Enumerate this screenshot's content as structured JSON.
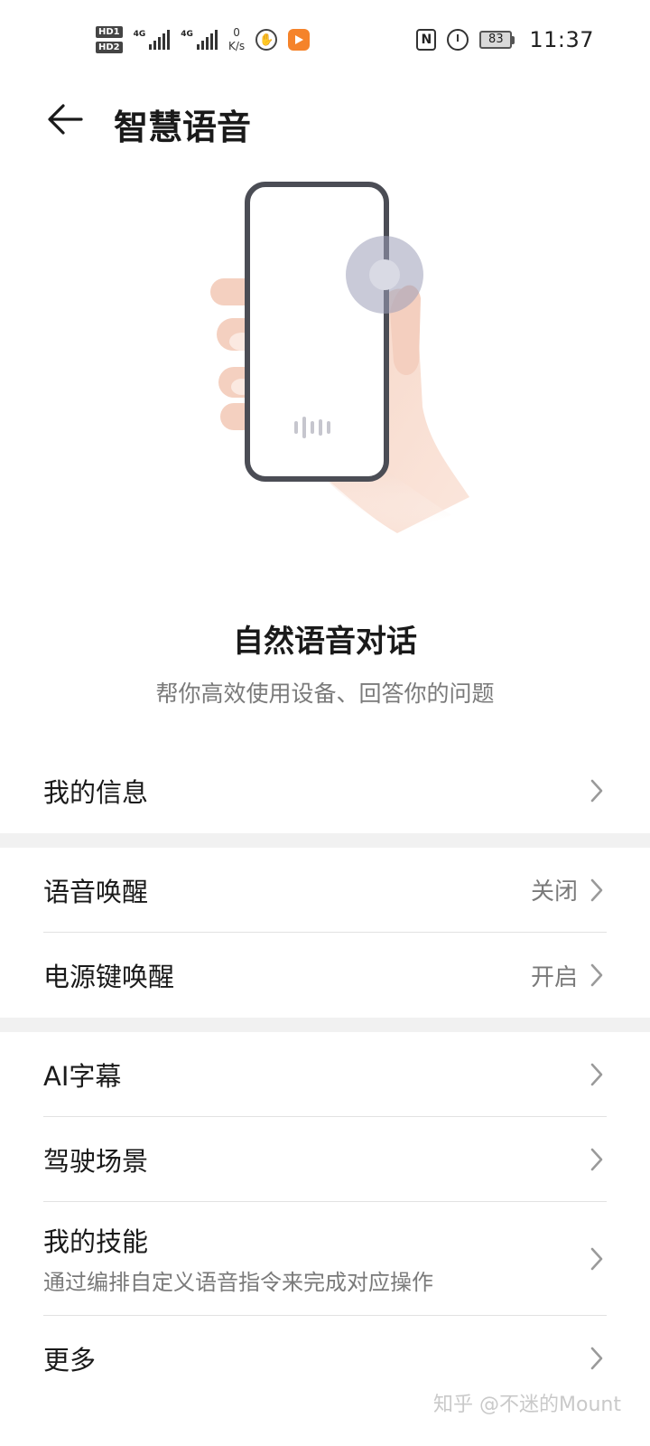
{
  "status_bar": {
    "hd1": "HD1",
    "hd2": "HD2",
    "sig1_tag": "4G",
    "sig2_tag": "4G",
    "net_speed_value": "0",
    "net_speed_unit": "K/s",
    "icons": [
      "hand-icon",
      "app-icon",
      "nfc-icon",
      "alarm-icon"
    ],
    "battery": "83",
    "time": "11:37"
  },
  "header": {
    "back_icon": "arrow-left-icon",
    "title": "智慧语音"
  },
  "hero": {
    "title": "自然语音对话",
    "subtitle": "帮你高效使用设备、回答你的问题"
  },
  "groups": [
    {
      "rows": [
        {
          "label": "我的信息",
          "value": ""
        }
      ]
    },
    {
      "rows": [
        {
          "label": "语音唤醒",
          "value": "关闭"
        },
        {
          "label": "电源键唤醒",
          "value": "开启"
        }
      ]
    },
    {
      "rows": [
        {
          "label": "AI字幕",
          "value": ""
        },
        {
          "label": "驾驶场景",
          "value": ""
        },
        {
          "label": "我的技能",
          "subtitle": "通过编排自定义语音指令来完成对应操作"
        },
        {
          "label": "更多",
          "value": ""
        }
      ]
    }
  ],
  "watermark": "知乎 @不迷的Mount",
  "colors": {
    "background": "#ffffff",
    "group_gap": "#f1f1f1",
    "secondary_text": "#7a7a7a",
    "chevron": "#9a9a9a"
  }
}
